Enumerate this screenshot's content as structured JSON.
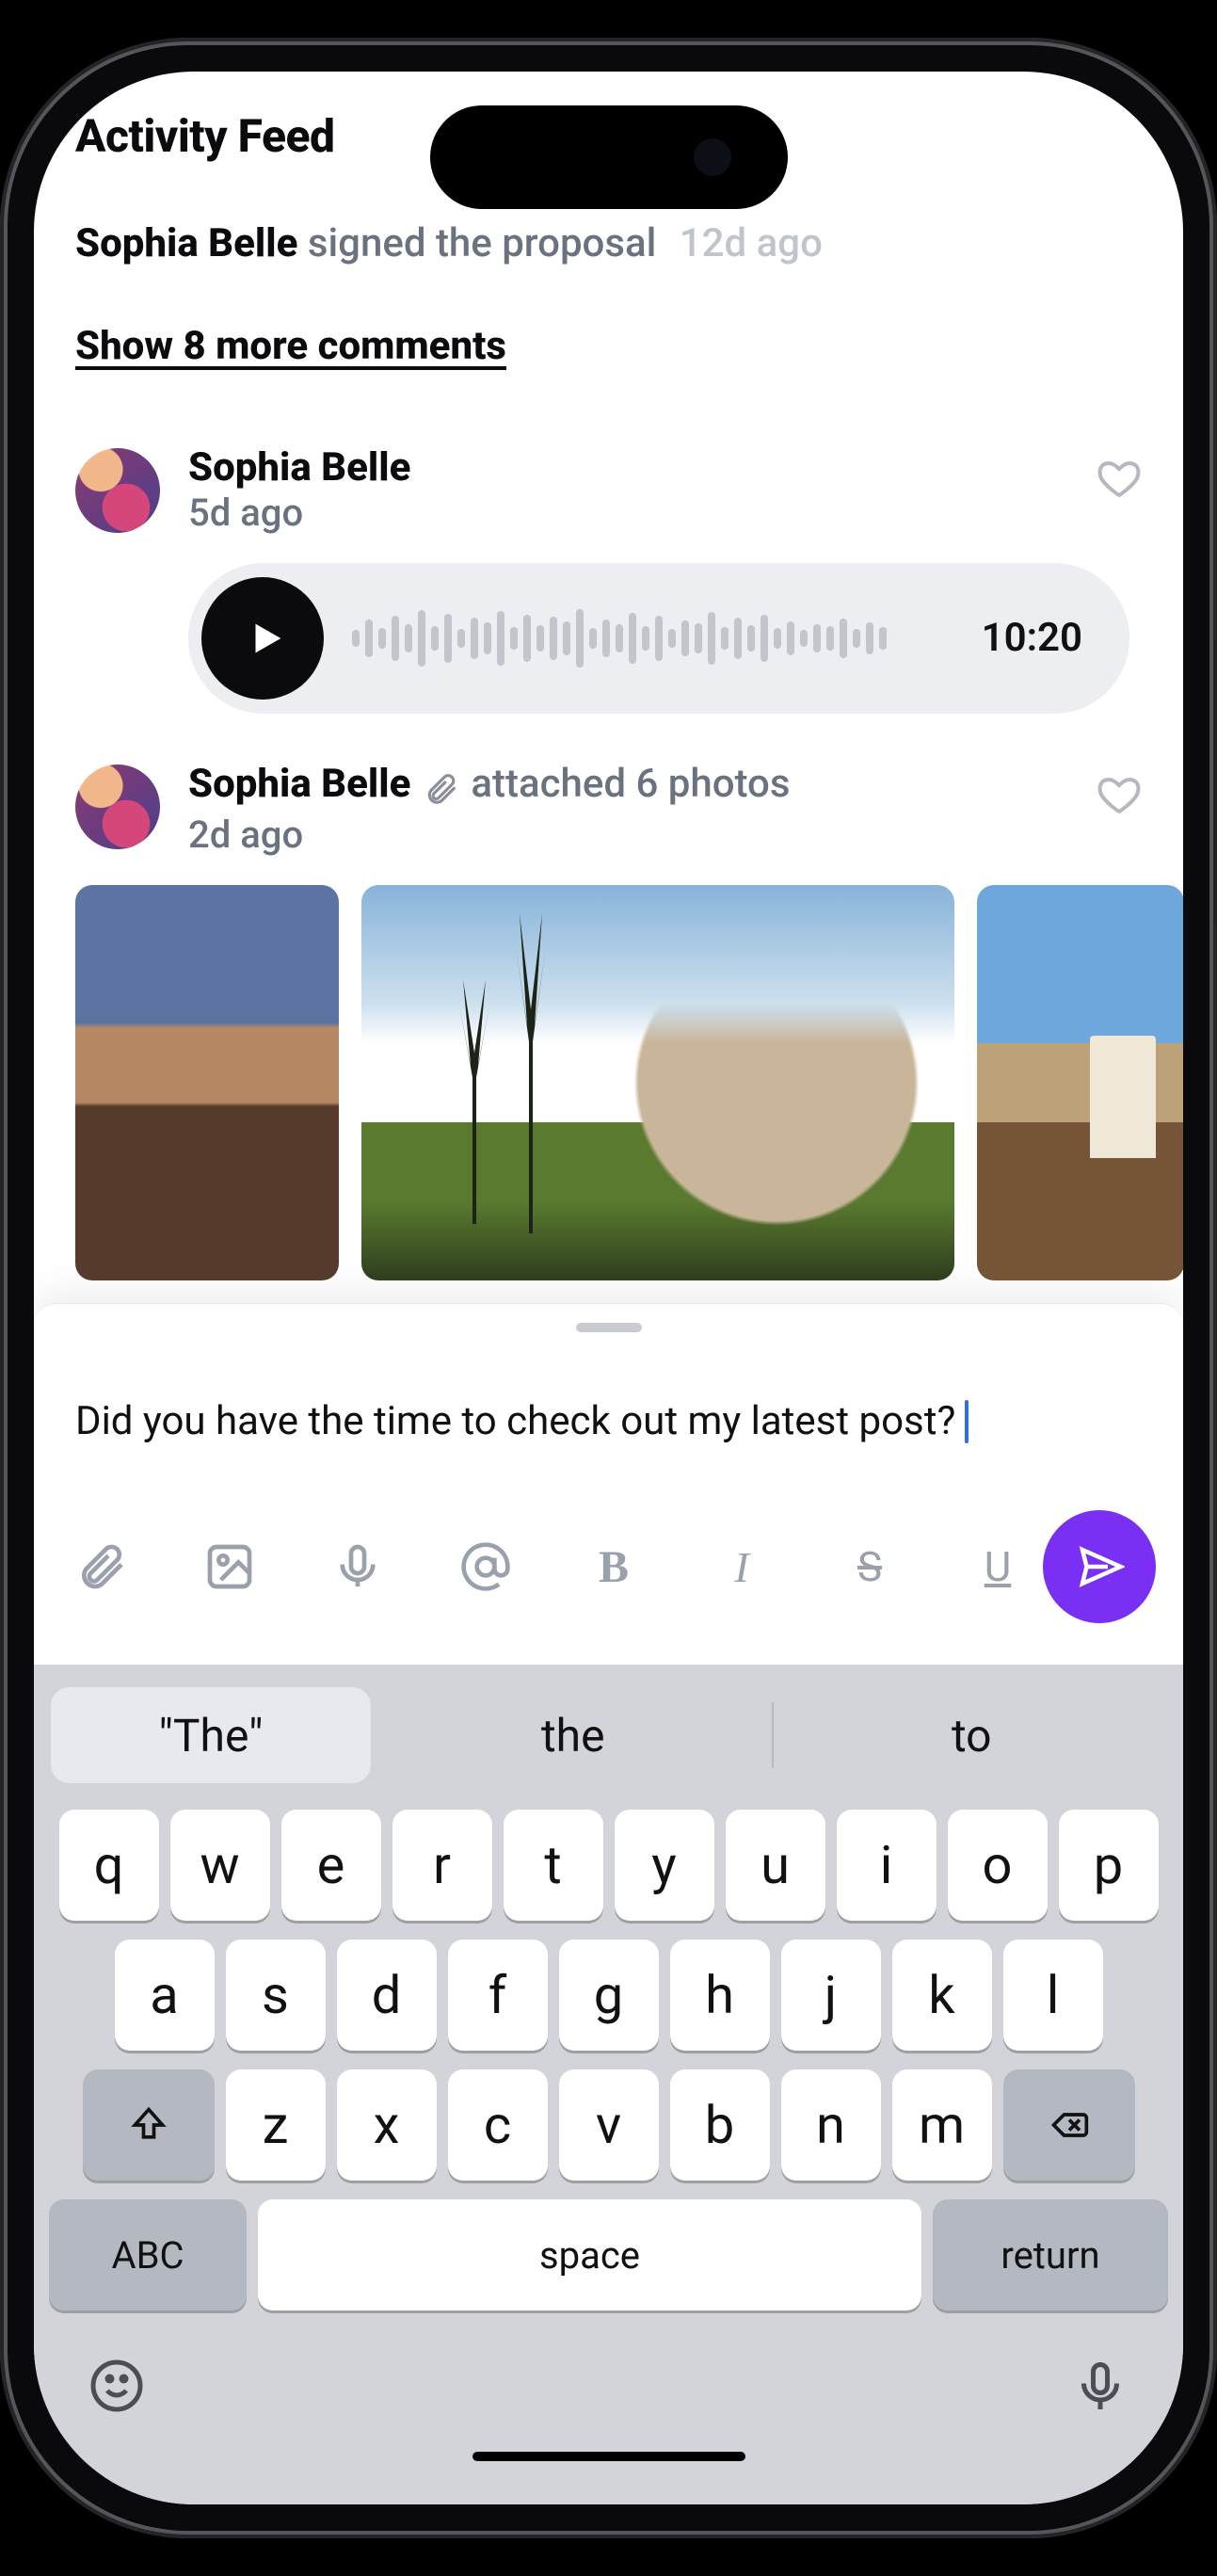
{
  "page_title": "Activity Feed",
  "event": {
    "actor": "Sophia Belle",
    "action": "signed the proposal",
    "time": "12d ago"
  },
  "show_more": "Show 8 more comments",
  "comment_voice": {
    "name": "Sophia Belle",
    "time": "5d ago",
    "duration": "10:20"
  },
  "comment_photos": {
    "name": "Sophia Belle",
    "time": "2d ago",
    "attach_text": "attached 6 photos"
  },
  "composer": {
    "text": "Did you have the time to check out my latest post?"
  },
  "suggestions": [
    "\"The\"",
    "the",
    "to"
  ],
  "kbd": {
    "row1": [
      "q",
      "w",
      "e",
      "r",
      "t",
      "y",
      "u",
      "i",
      "o",
      "p"
    ],
    "row2": [
      "a",
      "s",
      "d",
      "f",
      "g",
      "h",
      "j",
      "k",
      "l"
    ],
    "row3": [
      "z",
      "x",
      "c",
      "v",
      "b",
      "n",
      "m"
    ],
    "abc": "ABC",
    "space": "space",
    "return": "return"
  },
  "fmt": {
    "bold": "B",
    "italic": "I",
    "strike": "S",
    "under": "U"
  }
}
